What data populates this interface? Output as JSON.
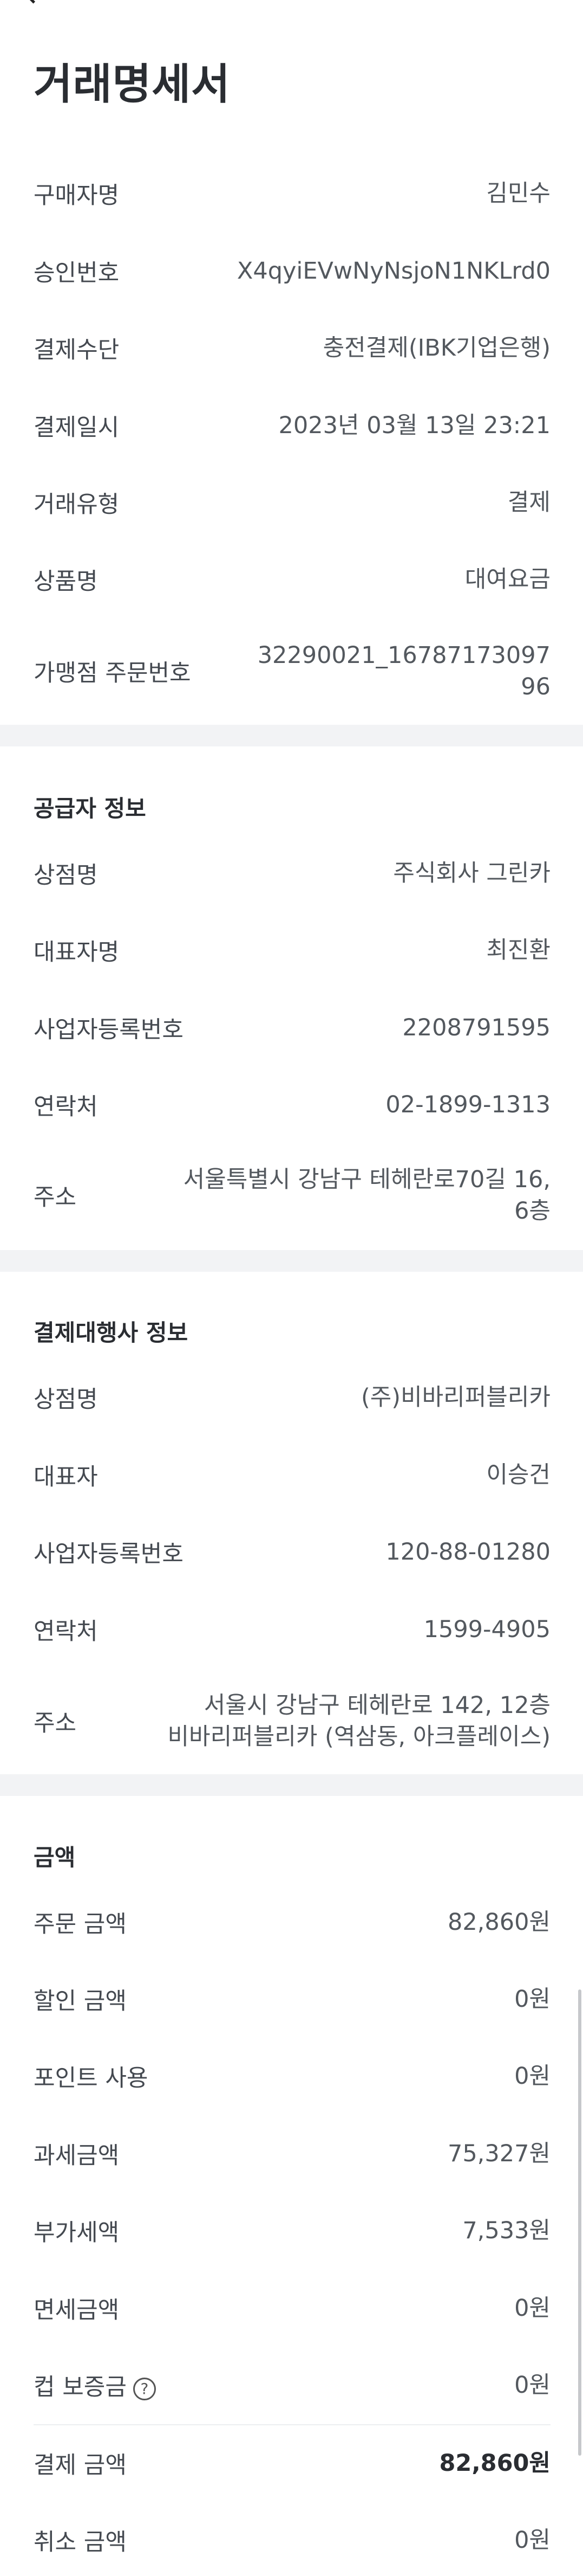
{
  "header": {
    "title": "거래명세서"
  },
  "receipt": [
    {
      "label": "구매자명",
      "value": "김민수"
    },
    {
      "label": "승인번호",
      "value": "X4qyiEVwNyNsjoN1NKLrd0"
    },
    {
      "label": "결제수단",
      "value": "충전결제(IBK기업은행)"
    },
    {
      "label": "결제일시",
      "value": "2023년 03월 13일 23:21"
    },
    {
      "label": "거래유형",
      "value": "결제"
    },
    {
      "label": "상품명",
      "value": "대여요금"
    },
    {
      "label": "가맹점 주문번호",
      "value": "32290021_16787173097\n96"
    }
  ],
  "supplier": {
    "title": "공급자 정보",
    "rows": [
      {
        "label": "상점명",
        "value": "주식회사 그린카"
      },
      {
        "label": "대표자명",
        "value": "최진환"
      },
      {
        "label": "사업자등록번호",
        "value": "2208791595"
      },
      {
        "label": "연락처",
        "value": "02-1899-1313"
      },
      {
        "label": "주소",
        "value": "서울특별시 강남구 테헤란로70길 16,\n6층"
      }
    ]
  },
  "pg": {
    "title": "결제대행사 정보",
    "rows": [
      {
        "label": "상점명",
        "value": "(주)비바리퍼블리카"
      },
      {
        "label": "대표자",
        "value": "이승건"
      },
      {
        "label": "사업자등록번호",
        "value": "120-88-01280"
      },
      {
        "label": "연락처",
        "value": "1599-4905"
      },
      {
        "label": "주소",
        "value": "서울시 강남구 테헤란로 142, 12층\n비바리퍼블리카 (역삼동, 아크플레이스)"
      }
    ]
  },
  "amount": {
    "title": "금액",
    "rows": [
      {
        "label": "주문 금액",
        "value": "82,860원"
      },
      {
        "label": "할인 금액",
        "value": "0원"
      },
      {
        "label": "포인트 사용",
        "value": "0원"
      },
      {
        "label": "과세금액",
        "value": "75,327원"
      },
      {
        "label": "부가세액",
        "value": "7,533원"
      },
      {
        "label": "면세금액",
        "value": "0원"
      },
      {
        "label": "컵 보증금",
        "value": "0원"
      }
    ],
    "cup_help_glyph": "?",
    "total": {
      "label": "결제 금액",
      "value": "82,860원"
    },
    "cancel": {
      "label": "취소 금액",
      "value": "0원"
    }
  }
}
